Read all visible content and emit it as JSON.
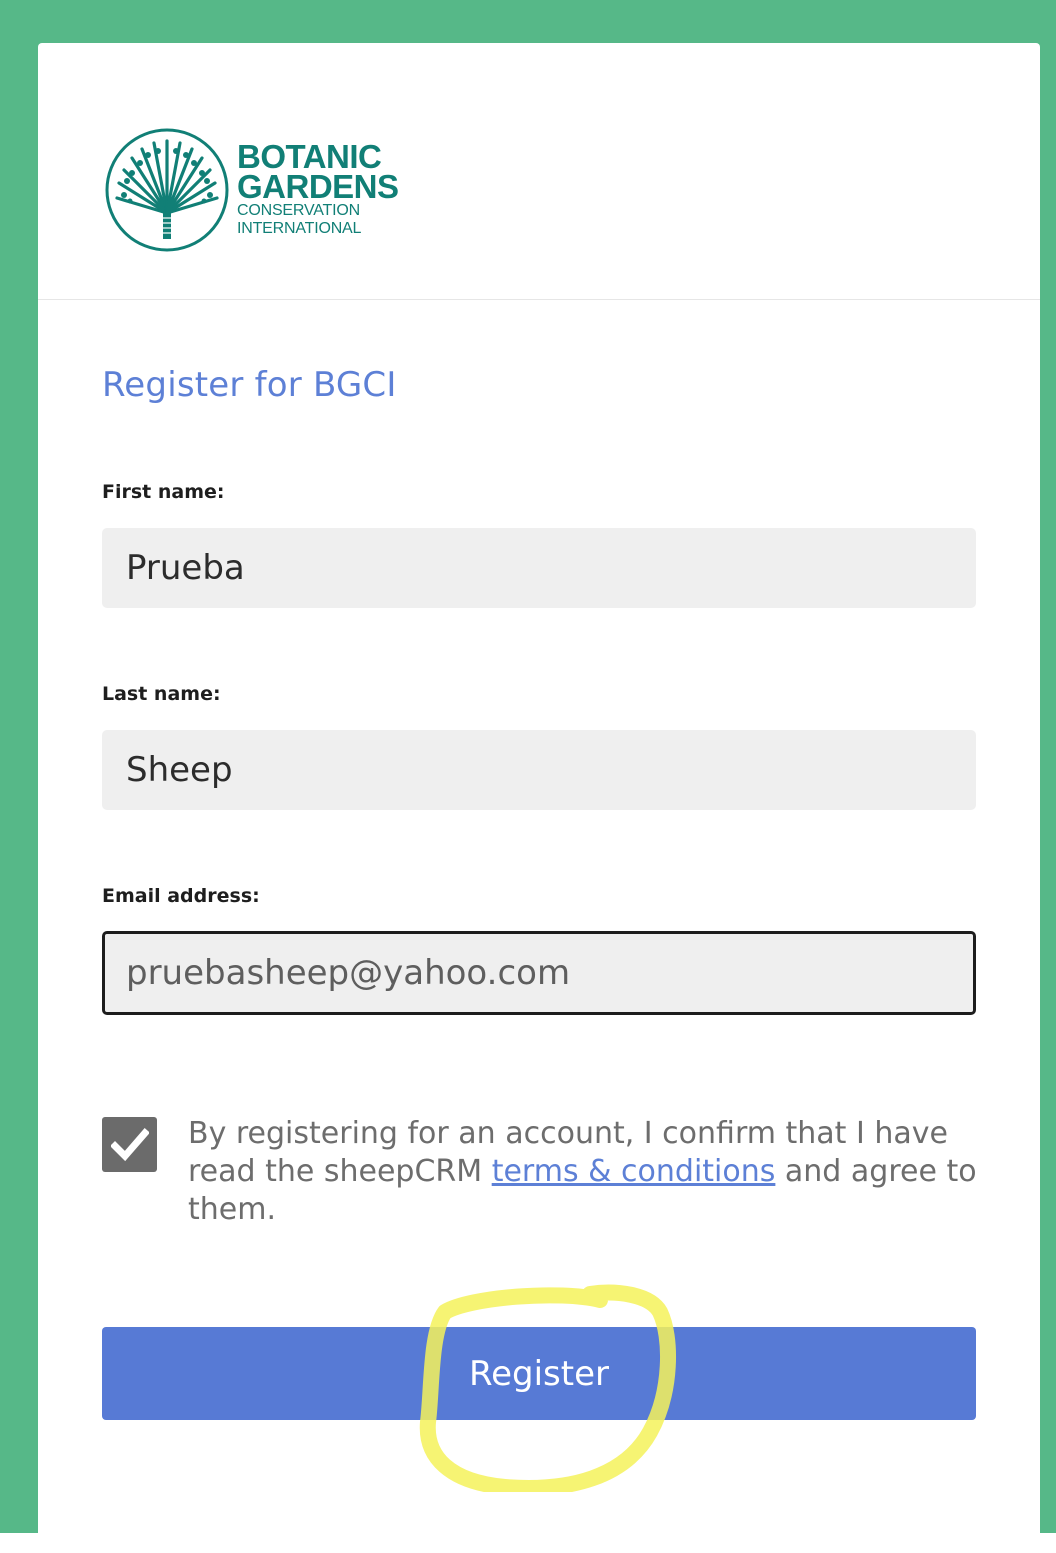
{
  "logo": {
    "line1": "BOTANIC",
    "line2": "GARDENS",
    "line3": "CONSERVATION",
    "line4": "INTERNATIONAL",
    "color": "#117f76"
  },
  "form": {
    "title": "Register for BGCI",
    "first_name": {
      "label": "First name:",
      "value": "Prueba"
    },
    "last_name": {
      "label": "Last name:",
      "value": "Sheep"
    },
    "email": {
      "label": "Email address:",
      "value": "pruebasheep@yahoo.com"
    },
    "consent": {
      "checked": true,
      "text_before": "By registering for an account, I confirm that I have read the sheepCRM ",
      "link_text": "terms & conditions",
      "text_after": " and agree to them."
    },
    "register_label": "Register"
  },
  "colors": {
    "frame": "#56b888",
    "accent": "#577ad5",
    "title": "#5d80d6",
    "highlight": "#f5f25a"
  },
  "annotation": {
    "type": "yellow-highlight-circle",
    "target": "register-button"
  }
}
